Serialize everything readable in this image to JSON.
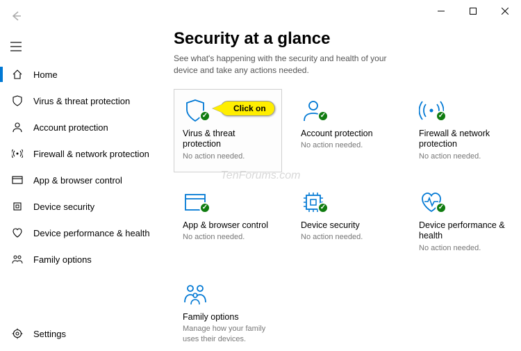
{
  "window_controls": {
    "minimize": "−",
    "maximize": "□",
    "close": "×"
  },
  "sidebar": {
    "items": [
      {
        "label": "Home"
      },
      {
        "label": "Virus & threat protection"
      },
      {
        "label": "Account protection"
      },
      {
        "label": "Firewall & network protection"
      },
      {
        "label": "App & browser control"
      },
      {
        "label": "Device security"
      },
      {
        "label": "Device performance & health"
      },
      {
        "label": "Family options"
      }
    ],
    "settings_label": "Settings"
  },
  "main": {
    "title": "Security at a glance",
    "subtitle": "See what's happening with the security and health of your device and take any actions needed."
  },
  "cards": [
    {
      "title": "Virus & threat protection",
      "sub": "No action needed."
    },
    {
      "title": "Account protection",
      "sub": "No action needed."
    },
    {
      "title": "Firewall & network protection",
      "sub": "No action needed."
    },
    {
      "title": "App & browser control",
      "sub": "No action needed."
    },
    {
      "title": "Device security",
      "sub": "No action needed."
    },
    {
      "title": "Device performance & health",
      "sub": "No action needed."
    },
    {
      "title": "Family options",
      "sub": "Manage how your family uses their devices."
    }
  ],
  "callout": "Click on",
  "watermark": "TenForums.com"
}
